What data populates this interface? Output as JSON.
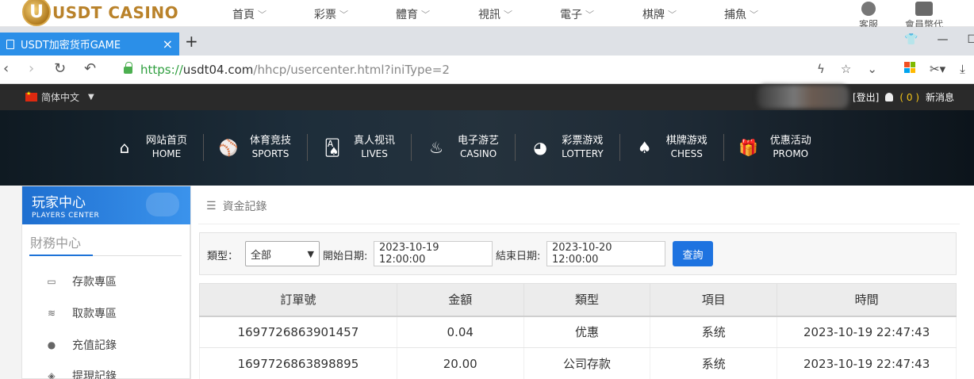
{
  "site": {
    "logo_text": "USDT CASINO",
    "logo_mark": "U",
    "top_nav": [
      "首頁",
      "彩票",
      "體育",
      "視訊",
      "電子",
      "棋牌",
      "捕魚"
    ],
    "kefu": "客服",
    "member": "會員幣代"
  },
  "browser": {
    "tab_title": "USDT加密货币GAME",
    "tab_close": "×",
    "new_tab": "+",
    "url_proto": "https://",
    "url_host": "usdt04.com",
    "url_path": "/hhcp/usercenter.html?iniType=2"
  },
  "topbar": {
    "language": "简体中文",
    "logout": "[登出]",
    "msg_count": "( 0 )",
    "msg_label": "新消息"
  },
  "menu": [
    {
      "cn": "网站首页",
      "en": "HOME",
      "icon": "home-icon",
      "glyph": "⌂"
    },
    {
      "cn": "体育竞技",
      "en": "SPORTS",
      "icon": "ball-icon",
      "glyph": "⚾"
    },
    {
      "cn": "真人视讯",
      "en": "LIVES",
      "icon": "cards-icon",
      "glyph": "🂡"
    },
    {
      "cn": "电子游艺",
      "en": "CASINO",
      "icon": "slot-icon",
      "glyph": "♨"
    },
    {
      "cn": "彩票游戏",
      "en": "LOTTERY",
      "icon": "lottery-icon",
      "glyph": "◕"
    },
    {
      "cn": "棋牌游戏",
      "en": "CHESS",
      "icon": "spade-icon",
      "glyph": "♠"
    },
    {
      "cn": "优惠活动",
      "en": "PROMO",
      "icon": "gift-icon",
      "glyph": "🎁"
    }
  ],
  "sidebar": {
    "title_cn": "玩家中心",
    "title_en": "PLAYERS CENTER",
    "section": "財務中心",
    "items": [
      {
        "label": "存款專區",
        "icon": "deposit-icon"
      },
      {
        "label": "取款專區",
        "icon": "withdraw-icon"
      },
      {
        "label": "充值記錄",
        "icon": "moneybag-icon"
      },
      {
        "label": "提現記錄",
        "icon": "withdraw-record-icon"
      }
    ]
  },
  "content": {
    "breadcrumb": "資金記錄",
    "filter": {
      "type_label": "類型：",
      "type_value": "全部",
      "start_label": "開始日期:",
      "start_value": "2023-10-19 12:00:00",
      "end_label": "結束日期:",
      "end_value": "2023-10-20 12:00:00",
      "query": "查詢"
    },
    "table": {
      "headers": [
        "訂單號",
        "金額",
        "類型",
        "項目",
        "時間"
      ],
      "rows": [
        [
          "1697726863901457",
          "0.04",
          "优惠",
          "系统",
          "2023-10-19 22:47:43"
        ],
        [
          "1697726863898895",
          "20.00",
          "公司存款",
          "系统",
          "2023-10-19 22:47:43"
        ]
      ]
    }
  }
}
